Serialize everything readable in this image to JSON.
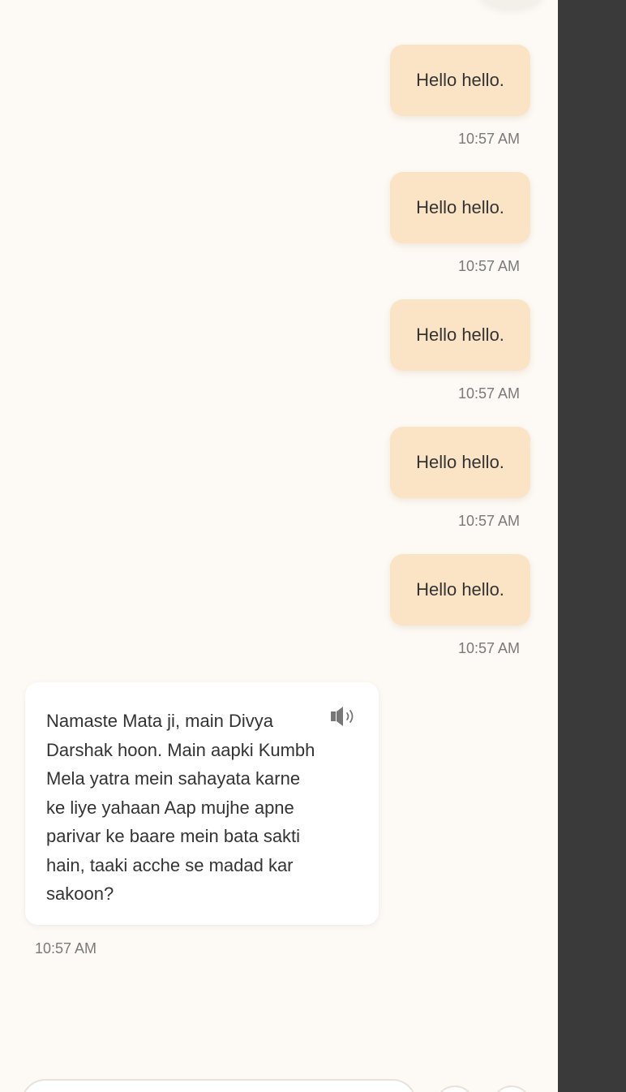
{
  "messages": {
    "user": [
      {
        "text": "Hello hello.",
        "time": "10:57 AM"
      },
      {
        "text": "Hello hello.",
        "time": "10:57 AM"
      },
      {
        "text": "Hello hello.",
        "time": "10:57 AM"
      },
      {
        "text": "Hello hello.",
        "time": "10:57 AM"
      },
      {
        "text": "Hello hello.",
        "time": "10:57 AM"
      }
    ],
    "bot": {
      "text": "Namaste Mata ji, main Divya Darshak hoon. Main aapki Kumbh Mela yatra mein sahayata karne ke liye yahaan Aap mujhe apne parivar ke baare mein bata sakti hain, taaki acche se madad kar sakoon?",
      "time": "10:57 AM",
      "icon": "speaker-icon"
    }
  },
  "colors": {
    "user_bubble": "#fbe3c6",
    "background": "#fdf9f4",
    "side_panel": "#3a3a3a"
  }
}
